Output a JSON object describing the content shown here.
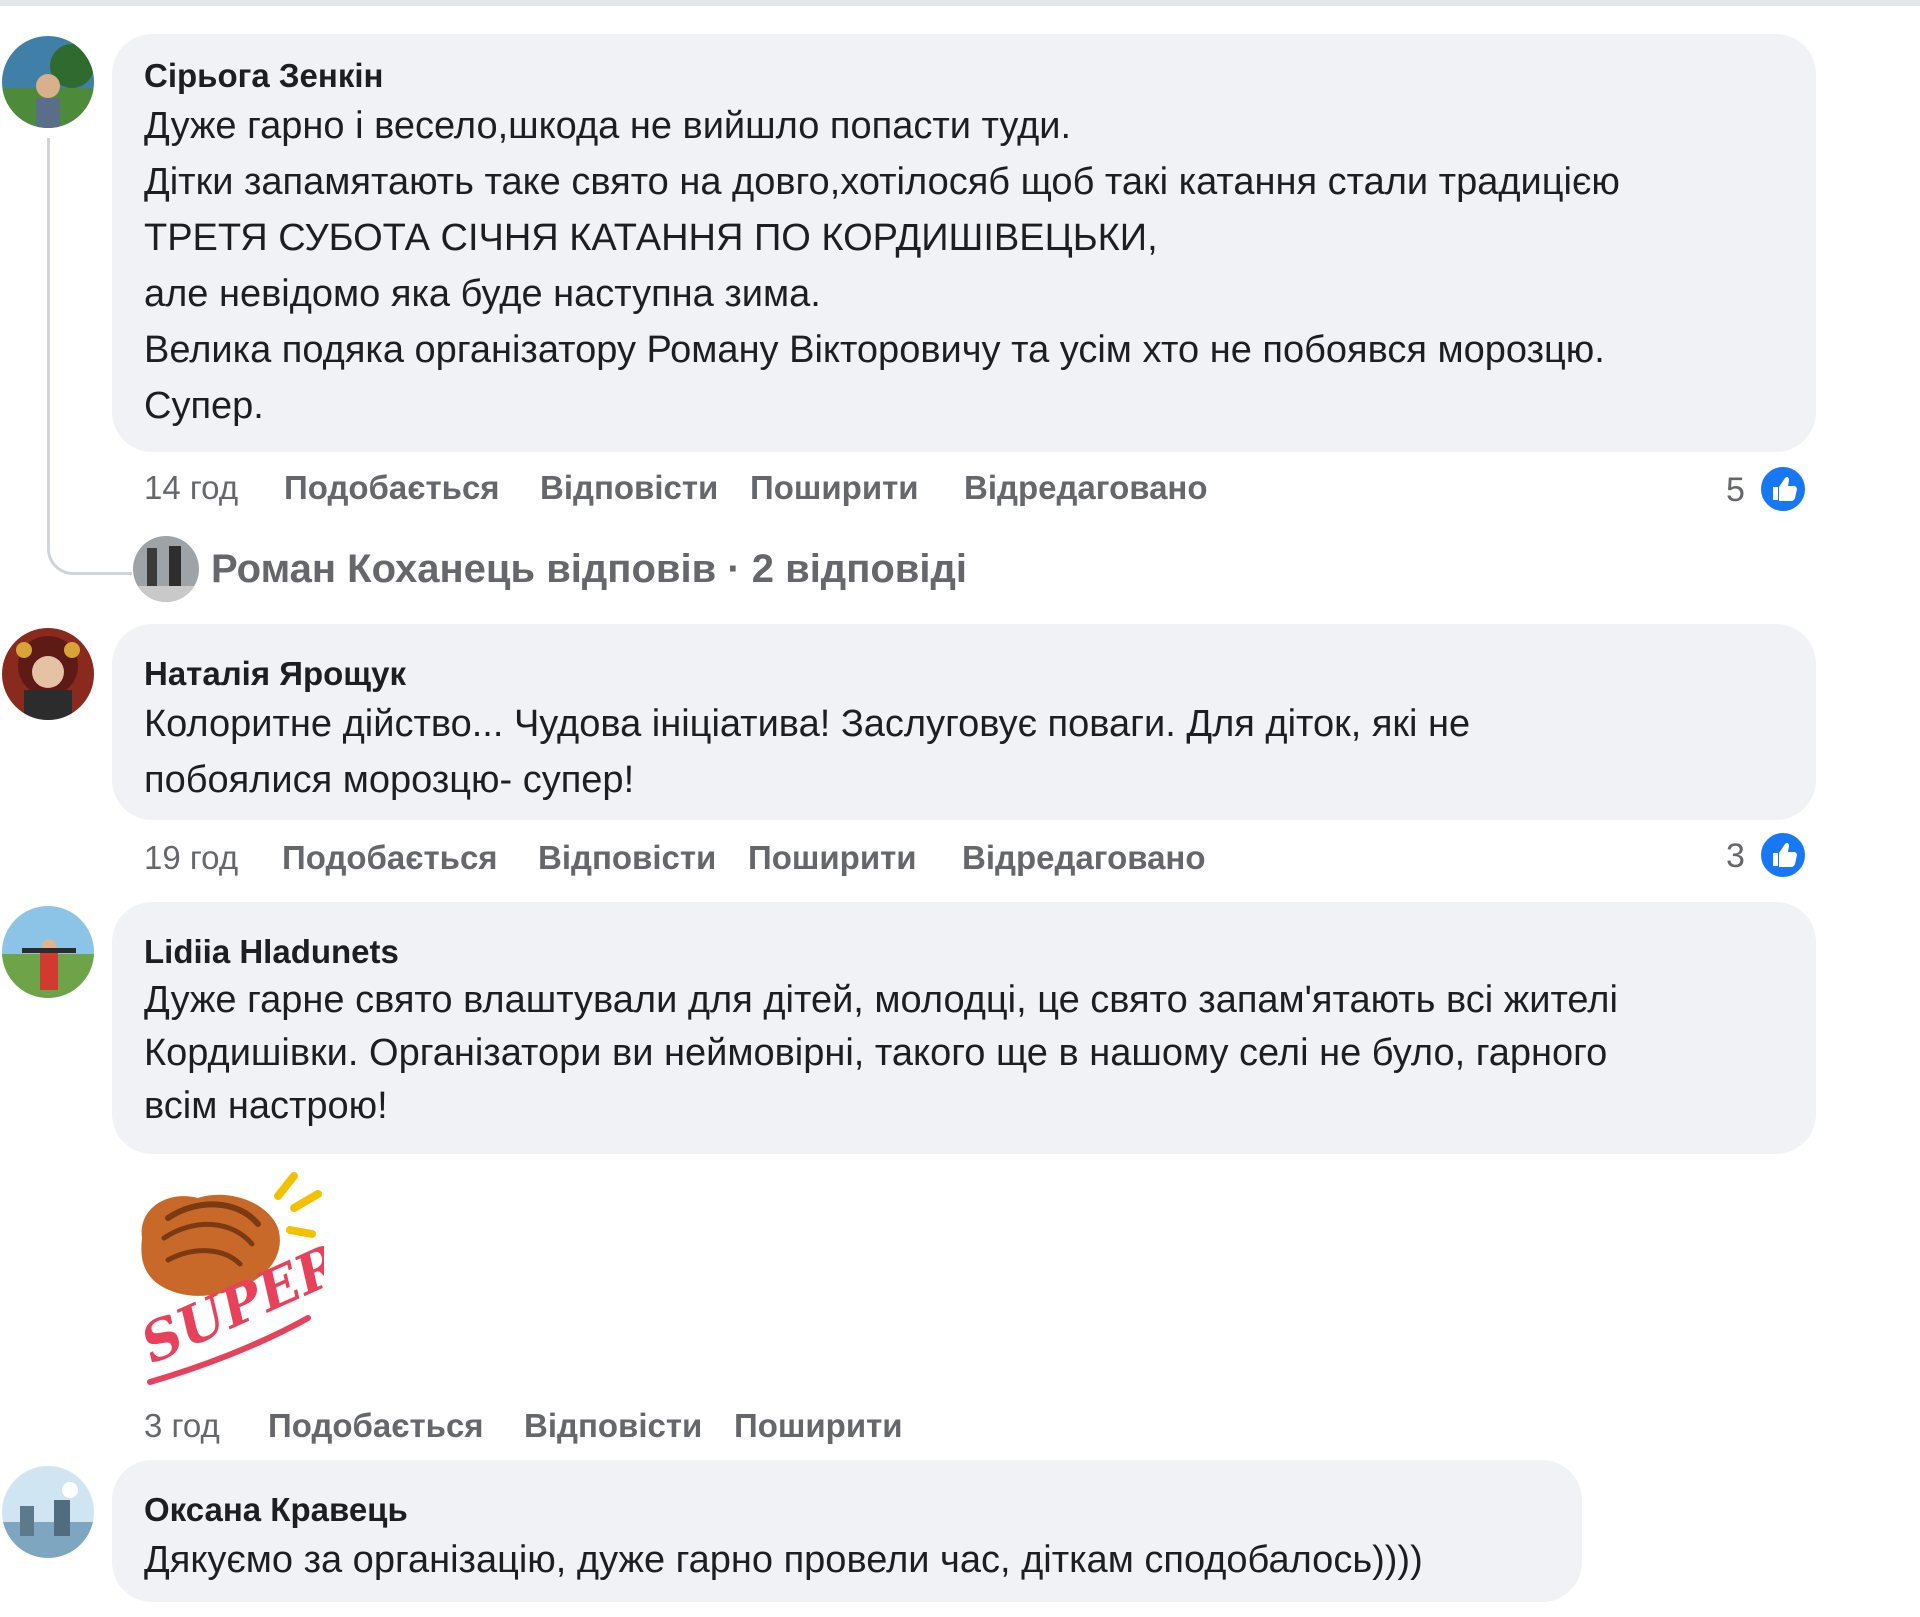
{
  "colors": {
    "bubble_bg": "#f0f2f5",
    "text": "#1c1e21",
    "secondary_text": "#65676b",
    "like_blue": "#1877f2"
  },
  "comments": [
    {
      "author": "Сірьога Зенкін",
      "lines": [
        "Дуже гарно і весело,шкода не вийшло попасти туди.",
        "Дітки запамятають таке свято на довго,хотілосяб щоб такі катання стали традицією",
        "ТРЕТЯ СУБОТА СІЧНЯ КАТАННЯ ПО КОРДИШІВЕЦЬКИ,",
        "але невідомо яка буде наступна зима.",
        "Велика подяка організатору Роману Вікторовичу та усім хто не побоявся морозцю.",
        "Супер."
      ],
      "time": "14 год",
      "like_label": "Подобається",
      "reply_label": "Відповісти",
      "share_label": "Поширити",
      "edited_label": "Відредаговано",
      "reaction_count": "5",
      "reaction_icon": "like-icon",
      "replies_summary": "Роман Коханець відповів · 2 відповіді"
    },
    {
      "author": "Наталія Ярощук",
      "lines": [
        "Колоритне дійство... Чудова ініціатива! Заслуговує поваги. Для діток, які не",
        "побоялися морозцю- супер!"
      ],
      "time": "19 год",
      "like_label": "Подобається",
      "reply_label": "Відповісти",
      "share_label": "Поширити",
      "edited_label": "Відредаговано",
      "reaction_count": "3",
      "reaction_icon": "like-icon"
    },
    {
      "author": "Lidiia Hladunets",
      "lines": [
        "Дуже гарне свято влаштували для дітей, молодці, це свято запам'ятають всі жителі",
        "Кордишівки. Організатори ви неймовірні, такого ще в нашому селі не було, гарного",
        "всім настрою!"
      ],
      "sticker_text": "SUPER!",
      "time": "3 год",
      "like_label": "Подобається",
      "reply_label": "Відповісти",
      "share_label": "Поширити"
    },
    {
      "author": "Оксана Кравець",
      "lines": [
        "Дякуємо за організацію, дуже гарно провели час, діткам сподобалось))))"
      ]
    }
  ]
}
